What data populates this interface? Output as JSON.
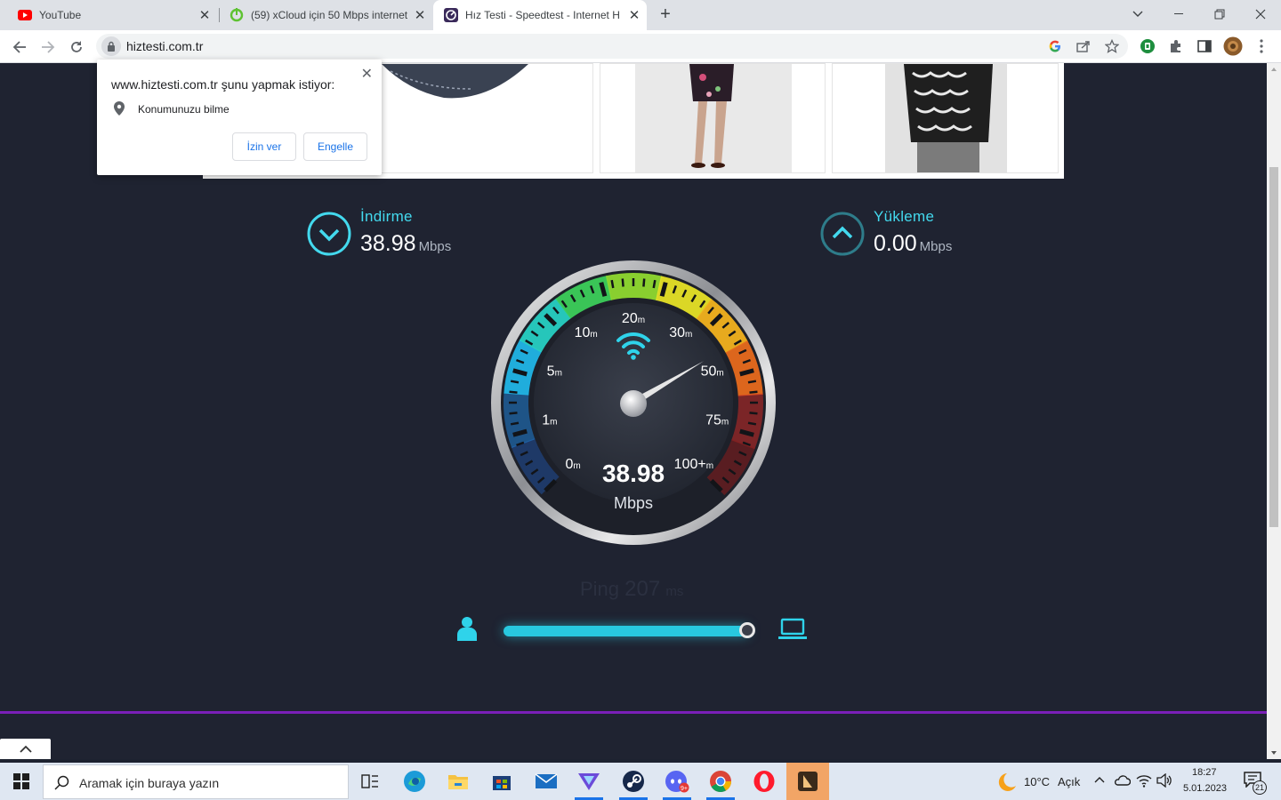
{
  "browser": {
    "tabs": [
      {
        "title": "YouTube",
        "favicon": "youtube-icon",
        "active": false
      },
      {
        "title": "(59) xCloud için 50 Mbps internet",
        "favicon": "xcloud-icon",
        "active": false
      },
      {
        "title": "Hız Testi - Speedtest - Internet H",
        "favicon": "speedtest-icon",
        "active": true
      }
    ],
    "url": "hiztesti.com.tr"
  },
  "permission_popup": {
    "title": "www.hiztesti.com.tr şunu yapmak istiyor:",
    "item": "Konumunuzu bilme",
    "allow": "İzin ver",
    "block": "Engelle"
  },
  "speedtest": {
    "download": {
      "label": "İndirme",
      "value": "38.98",
      "unit": "Mbps"
    },
    "upload": {
      "label": "Yükleme",
      "value": "0.00",
      "unit": "Mbps"
    },
    "gauge": {
      "value": "38.98",
      "unit": "Mbps",
      "ticks": [
        {
          "n": "0",
          "s": "m"
        },
        {
          "n": "1",
          "s": "m"
        },
        {
          "n": "5",
          "s": "m"
        },
        {
          "n": "10",
          "s": "m"
        },
        {
          "n": "20",
          "s": "m"
        },
        {
          "n": "30",
          "s": "m"
        },
        {
          "n": "50",
          "s": "m"
        },
        {
          "n": "75",
          "s": "m"
        },
        {
          "n": "100+",
          "s": "m"
        }
      ],
      "needle_fraction": 0.72
    },
    "ping": {
      "label": "Ping",
      "value": "207",
      "unit": "ms"
    },
    "progress": 1.0
  },
  "taskbar": {
    "search_placeholder": "Aramak için buraya yazın",
    "weather_temp": "10°C",
    "weather_cond": "Açık",
    "time": "18:27",
    "date": "5.01.2023",
    "notifications": "21",
    "apps": [
      "task-view-icon",
      "edge-icon",
      "file-explorer-icon",
      "store-icon",
      "mail-icon",
      "vpn-icon",
      "steam-icon",
      "discord-icon",
      "chrome-icon",
      "opera-icon",
      "app-icon"
    ]
  },
  "colors": {
    "accent": "#43d9ee",
    "page_bg": "#1f2331",
    "purple_divider": "#7a1fb8"
  }
}
